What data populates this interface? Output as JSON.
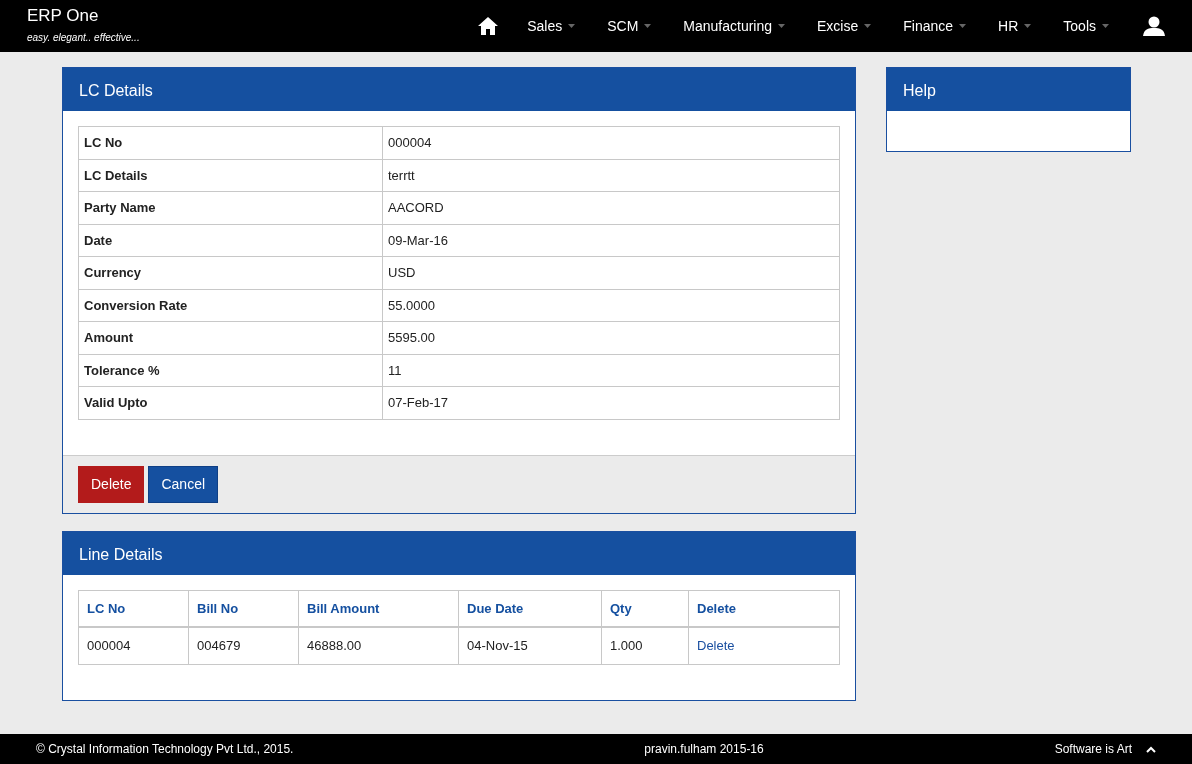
{
  "brand": {
    "title": "ERP One",
    "tagline": "easy. elegant.. effective..."
  },
  "nav_items": [
    "Sales",
    "SCM",
    "Manufacturing",
    "Excise",
    "Finance",
    "HR",
    "Tools"
  ],
  "lc_panel": {
    "title": "LC Details",
    "fields": [
      {
        "label": "LC No",
        "value": "000004"
      },
      {
        "label": "LC Details",
        "value": "terrtt"
      },
      {
        "label": "Party Name",
        "value": "AACORD"
      },
      {
        "label": "Date",
        "value": "09-Mar-16"
      },
      {
        "label": "Currency",
        "value": "USD"
      },
      {
        "label": "Conversion Rate",
        "value": "55.0000"
      },
      {
        "label": "Amount",
        "value": "5595.00"
      },
      {
        "label": "Tolerance %",
        "value": "11"
      },
      {
        "label": "Valid Upto",
        "value": "07-Feb-17"
      }
    ],
    "buttons": [
      {
        "label": "Delete",
        "kind": "danger"
      },
      {
        "label": "Cancel",
        "kind": "primary"
      }
    ]
  },
  "line_panel": {
    "title": "Line Details",
    "columns": [
      "LC No",
      "Bill No",
      "Bill Amount",
      "Due Date",
      "Qty",
      "Delete"
    ],
    "rows": [
      {
        "cells": [
          "000004",
          "004679",
          "46888.00",
          "04-Nov-15",
          "1.000"
        ],
        "action": "Delete"
      }
    ]
  },
  "help_panel": {
    "title": "Help"
  },
  "footer": {
    "copyright": "© Crystal Information Technology Pvt Ltd., 2015.",
    "user": "pravin.fulham 2015-16",
    "motto": "Software is Art"
  }
}
